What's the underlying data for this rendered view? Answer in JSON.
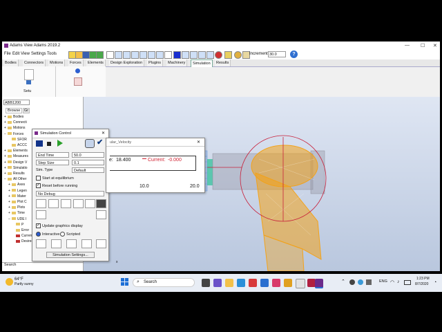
{
  "window": {
    "title": "Adams View Adams 2019.2",
    "controls": [
      "—",
      "☐",
      "✕"
    ]
  },
  "menubar": {
    "items": [
      "File",
      "Edit",
      "View",
      "Settings",
      "Tools"
    ],
    "increment_label": "Increment",
    "increment_value": "30.0"
  },
  "tabs": [
    "Bodies",
    "Connectors",
    "Motions",
    "Forces",
    "Elements",
    "Design Exploration",
    "Plugins",
    "Machinery",
    "Simulation",
    "Results"
  ],
  "active_tab": "Simulation",
  "ribbon": {
    "label": "Setu"
  },
  "tree": {
    "model_field": "ABB1200",
    "tabs": [
      "Browse",
      "Gr"
    ],
    "items": [
      {
        "label": "Bodies",
        "indent": 0,
        "exp": "+"
      },
      {
        "label": "Connecti",
        "indent": 0,
        "exp": "+"
      },
      {
        "label": "Motions",
        "indent": 0,
        "exp": "+"
      },
      {
        "label": "Forces",
        "indent": 0,
        "exp": "−"
      },
      {
        "label": "SFOR",
        "indent": 1,
        "exp": ""
      },
      {
        "label": "ACCC",
        "indent": 1,
        "exp": ""
      },
      {
        "label": "Elements",
        "indent": 0,
        "exp": "+"
      },
      {
        "label": "Measures",
        "indent": 0,
        "exp": "+"
      },
      {
        "label": "Design V",
        "indent": 0,
        "exp": "+"
      },
      {
        "label": "Simulatio",
        "indent": 0,
        "exp": "+"
      },
      {
        "label": "Results",
        "indent": 0,
        "exp": "+"
      },
      {
        "label": "All Other",
        "indent": 0,
        "exp": "−"
      },
      {
        "label": "Axes",
        "indent": 1,
        "exp": "+"
      },
      {
        "label": "Legen",
        "indent": 1,
        "exp": "+"
      },
      {
        "label": "Mater",
        "indent": 1,
        "exp": "+"
      },
      {
        "label": "Plot C",
        "indent": 1,
        "exp": "+"
      },
      {
        "label": "Plots",
        "indent": 1,
        "exp": "+"
      },
      {
        "label": "Time",
        "indent": 1,
        "exp": "+"
      },
      {
        "label": "UDE I",
        "indent": 1,
        "exp": "−"
      },
      {
        "label": "P",
        "indent": 2,
        "exp": ""
      },
      {
        "label": "Error",
        "indent": 2,
        "exp": ""
      },
      {
        "label": "Current",
        "indent": 2,
        "exp": ""
      },
      {
        "label": "Desired",
        "indent": 2,
        "exp": ""
      }
    ],
    "search_label": "Search"
  },
  "simctl": {
    "title": "Simulation Control",
    "end_mode": "End Time",
    "end_value": "50.0",
    "step_mode": "Step Size",
    "step_value": "0.1",
    "sim_type_label": "Sim. Type",
    "sim_type_value": "Default",
    "start_eq_label": "Start at equilibrium",
    "reset_label": "Reset before running",
    "debug_value": "No Debug",
    "update_label": "Update graphics display",
    "interactive_label": "Interactive",
    "scripted_label": "Scripted",
    "settings_button": "Simulation Settings..."
  },
  "strip": {
    "title": "ular_Velocity",
    "value_label": "e:",
    "value": "18.400",
    "current_label": "Current:",
    "current_value": "-0.000",
    "tick_mid": "10.0",
    "tick_end": "20.0",
    "time_range": [
      0,
      20
    ],
    "current_color": "#d02030"
  },
  "taskbar": {
    "weather_temp": "64°F",
    "weather_desc": "Partly sunny",
    "search": "Search",
    "lang": "ENG",
    "time": "1:23 PM",
    "date": "8/7/2020"
  },
  "viewport": {
    "axis_y": "y",
    "axis_x": "x",
    "accent_blue": "#6aa0e8",
    "accent_orange": "#f2a21a",
    "accent_red": "#c8203a"
  }
}
